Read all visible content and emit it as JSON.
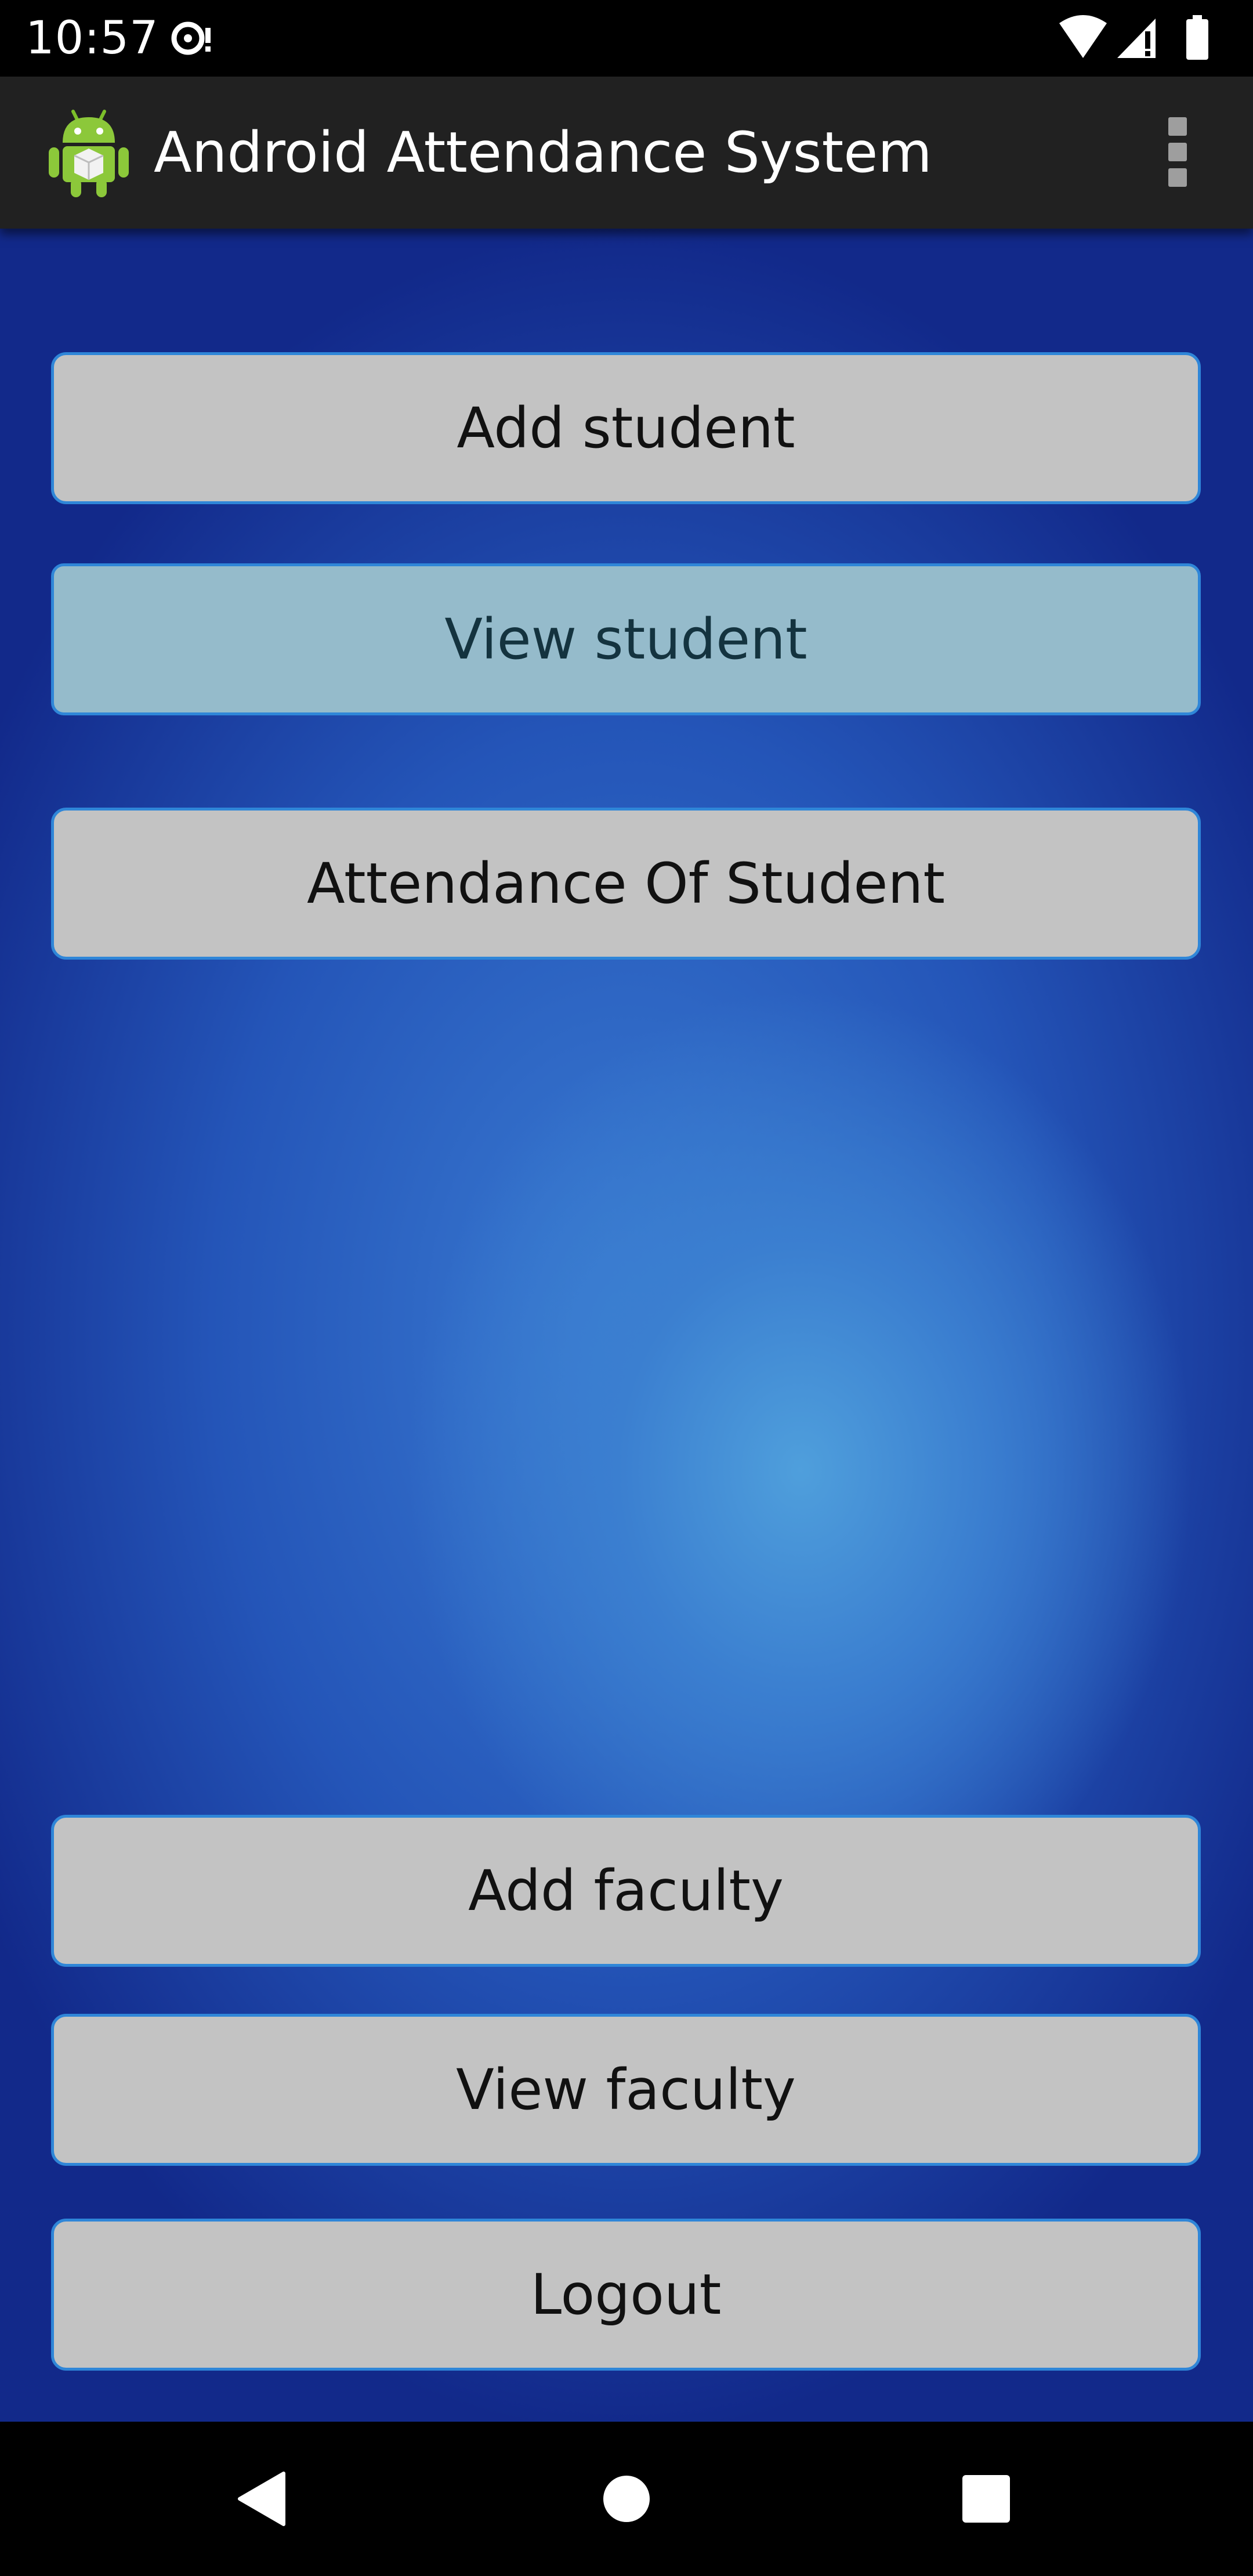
{
  "status_bar": {
    "time": "10:57",
    "icons": [
      "notification-icon",
      "wifi-icon",
      "cell-signal-icon",
      "battery-icon"
    ]
  },
  "app_bar": {
    "title": "Android Attendance System",
    "logo_icon": "android-logo-icon",
    "menu_icon": "overflow-menu-icon"
  },
  "buttons": {
    "add_student": "Add student",
    "view_student": "View student",
    "attendance_of_student": "Attendance Of Student",
    "add_faculty": "Add faculty",
    "view_faculty": "View faculty",
    "logout": "Logout"
  },
  "nav_bar": {
    "icons": [
      "back-icon",
      "home-icon",
      "recents-icon"
    ]
  },
  "colors": {
    "button_bg": "#c3c3c3",
    "button_pressed_bg": "#95bbcb",
    "button_border": "#2f86d8",
    "app_bar_bg": "#212121",
    "background_blue": "#2455b8"
  }
}
